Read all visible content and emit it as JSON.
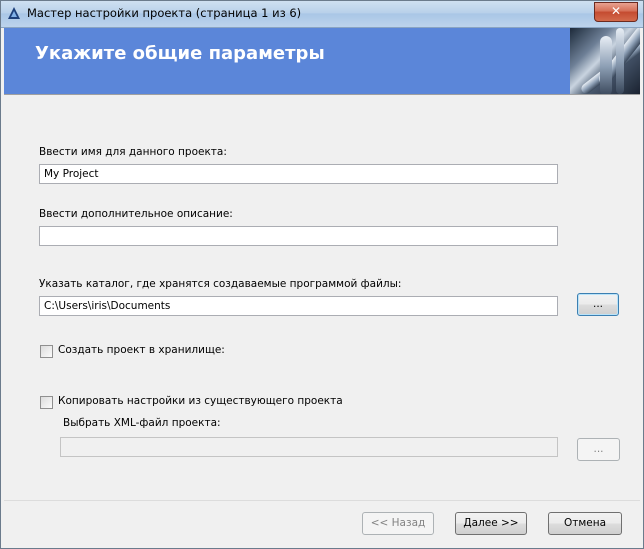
{
  "window": {
    "title": "Мастер настройки проекта (страница 1 из 6)",
    "close_label": "✕"
  },
  "banner": {
    "title": "Укажите общие параметры"
  },
  "form": {
    "project_name_label": "Ввести имя для данного проекта:",
    "project_name_value": "My Project",
    "description_label": "Ввести дополнительное описание:",
    "description_value": "",
    "folder_label": "Указать каталог, где хранятся создаваемые программой файлы:",
    "folder_value": "C:\\Users\\iris\\Documents",
    "browse_label": "...",
    "vault_checkbox_label": "Создать проект в хранилище:",
    "vault_checked": false,
    "copy_settings_label": "Копировать настройки из существующего проекта",
    "copy_settings_checked": false,
    "xml_label": "Выбрать XML-файл проекта:",
    "xml_value": "",
    "xml_browse_label": "..."
  },
  "buttons": {
    "back": "<< Назад",
    "next": "Далее >>",
    "cancel": "Отмена"
  },
  "colors": {
    "banner": "#5b86d9",
    "close": "#c44b30"
  }
}
